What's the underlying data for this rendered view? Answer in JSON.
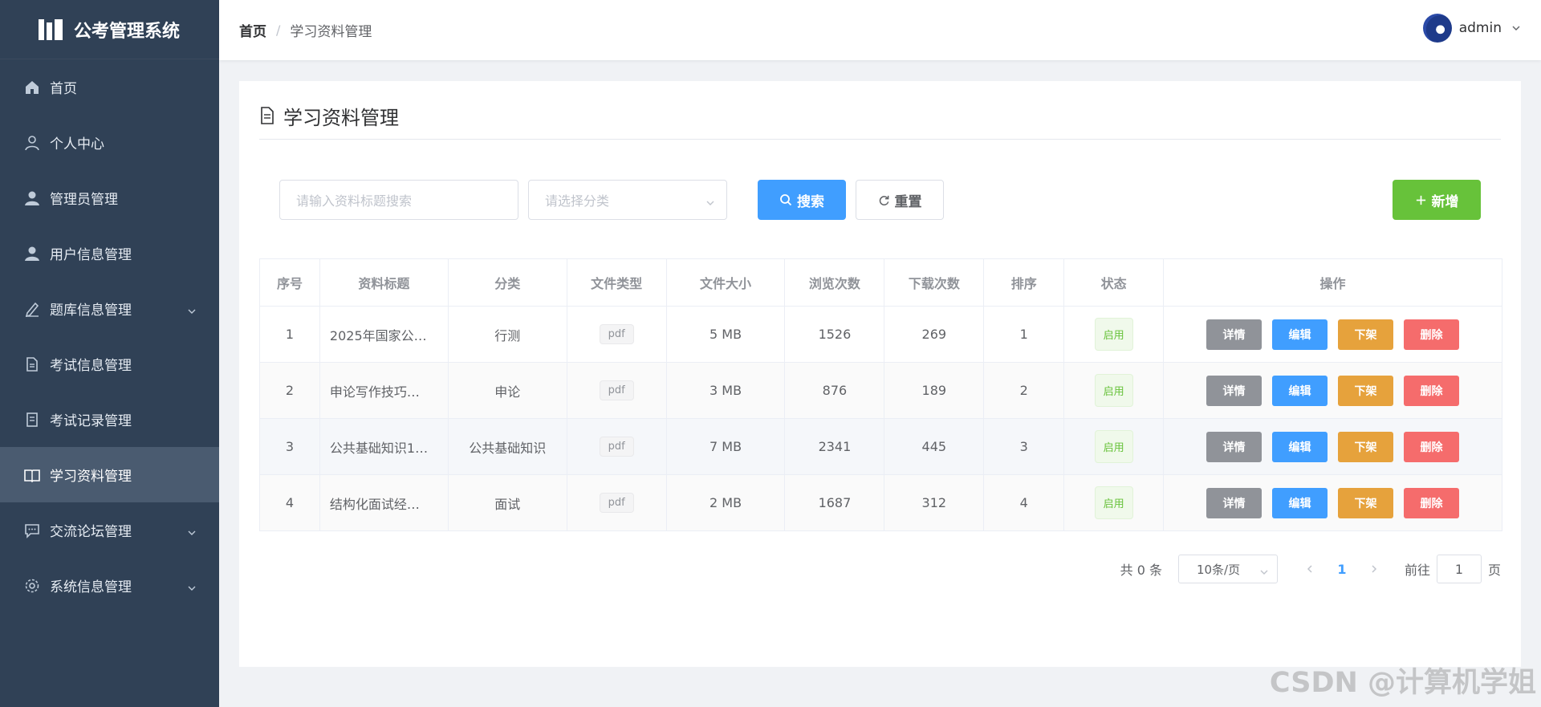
{
  "app": {
    "title": "公考管理系统"
  },
  "sidebar": {
    "items": [
      {
        "label": "首页",
        "icon": "home-icon"
      },
      {
        "label": "个人中心",
        "icon": "user-outline-icon"
      },
      {
        "label": "管理员管理",
        "icon": "user-solid-icon"
      },
      {
        "label": "用户信息管理",
        "icon": "user-solid-icon"
      },
      {
        "label": "题库信息管理",
        "icon": "edit-icon"
      },
      {
        "label": "考试信息管理",
        "icon": "document-icon"
      },
      {
        "label": "考试记录管理",
        "icon": "tickets-icon"
      },
      {
        "label": "学习资料管理",
        "icon": "reading-icon"
      },
      {
        "label": "交流论坛管理",
        "icon": "chat-icon"
      },
      {
        "label": "系统信息管理",
        "icon": "setting-icon"
      }
    ]
  },
  "breadcrumb": {
    "home": "首页",
    "separator": "/",
    "current": "学习资料管理"
  },
  "user": {
    "name": "admin"
  },
  "page": {
    "title": "学习资料管理"
  },
  "search": {
    "title_placeholder": "请输入资料标题搜索",
    "category_placeholder": "请选择分类",
    "search_label": "搜索",
    "reset_label": "重置",
    "add_label": "新增"
  },
  "table": {
    "headers": [
      "序号",
      "资料标题",
      "分类",
      "文件类型",
      "文件大小",
      "浏览次数",
      "下载次数",
      "排序",
      "状态",
      "操作"
    ],
    "rows": [
      {
        "index": "1",
        "title": "2025年国家公…",
        "category": "行测",
        "type": "pdf",
        "size": "5 MB",
        "views": "1526",
        "downloads": "269",
        "order": "1",
        "status": "启用"
      },
      {
        "index": "2",
        "title": "申论写作技巧…",
        "category": "申论",
        "type": "pdf",
        "size": "3 MB",
        "views": "876",
        "downloads": "189",
        "order": "2",
        "status": "启用"
      },
      {
        "index": "3",
        "title": "公共基础知识1…",
        "category": "公共基础知识",
        "type": "pdf",
        "size": "7 MB",
        "views": "2341",
        "downloads": "445",
        "order": "3",
        "status": "启用"
      },
      {
        "index": "4",
        "title": "结构化面试经…",
        "category": "面试",
        "type": "pdf",
        "size": "2 MB",
        "views": "1687",
        "downloads": "312",
        "order": "4",
        "status": "启用"
      }
    ],
    "actions": {
      "detail": "详情",
      "edit": "编辑",
      "offline": "下架",
      "delete": "删除"
    }
  },
  "pagination": {
    "total": "共 0 条",
    "page_size": "10条/页",
    "current_page": "1",
    "goto_label": "前往",
    "goto_value": "1",
    "page_suffix": "页"
  },
  "watermark": "CSDN @计算机学姐",
  "colors": {
    "sidebar_bg": "#304156",
    "primary": "#409eff",
    "success": "#67c23a",
    "warning": "#e6a23c",
    "danger": "#f56c6c",
    "info": "#909399"
  }
}
